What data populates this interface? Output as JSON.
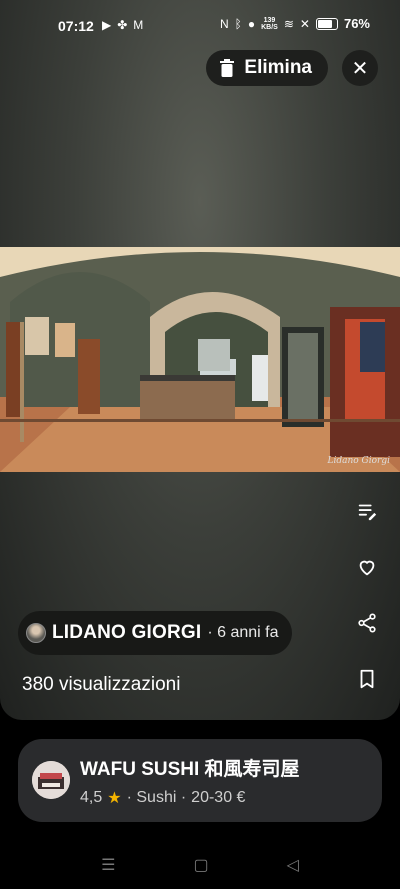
{
  "status_bar": {
    "time": "07:12",
    "network_speed_value": "139",
    "network_speed_unit": "KB/S",
    "battery": "76%"
  },
  "toolbar": {
    "delete_label": "Elimina",
    "close_icon": "close-icon"
  },
  "photo": {
    "credit": "Lidano Giorgi"
  },
  "author": {
    "name": "LIDANO GIORGI",
    "time": "· 6 anni fa"
  },
  "stats": {
    "views": "380 visualizzazioni"
  },
  "place": {
    "name": "WAFU SUSHI 和風寿司屋",
    "rating": "4,5",
    "category": "· Sushi ·",
    "price": "20-30 €"
  },
  "side_actions": [
    "edit-caption-icon",
    "heart-icon",
    "share-icon",
    "bookmark-icon"
  ],
  "colors": {
    "star": "#f4b400",
    "card": "#2a2b2d",
    "chip": "#181917"
  }
}
